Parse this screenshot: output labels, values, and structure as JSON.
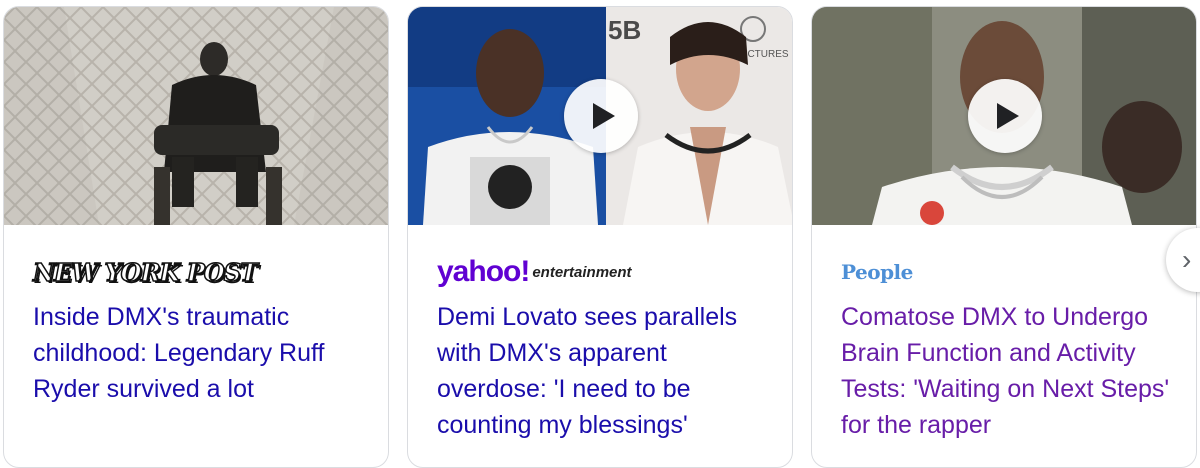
{
  "cards": [
    {
      "source": "NEW YORK POST",
      "headline": "Inside DMX's traumatic childhood: Legendary Ruff Ryder survived a lot",
      "has_video": false,
      "visited": false
    },
    {
      "source_main": "yahoo!",
      "source_sub": "entertainment",
      "headline": "Demi Lovato sees parallels with DMX's apparent overdose: 'I need to be counting my blessings'",
      "has_video": true,
      "visited": false
    },
    {
      "source": "People",
      "headline": "Comatose DMX to Undergo Brain Function and Activity Tests: 'Waiting on Next Steps' for the rapper",
      "has_video": true,
      "visited": true
    }
  ],
  "icons": {
    "play": "play-icon",
    "next": "chevron-right-icon"
  },
  "colors": {
    "link": "#1a0dab",
    "visited_link": "#681da8",
    "yahoo": "#6001d2",
    "people": "#4d8fd6"
  }
}
